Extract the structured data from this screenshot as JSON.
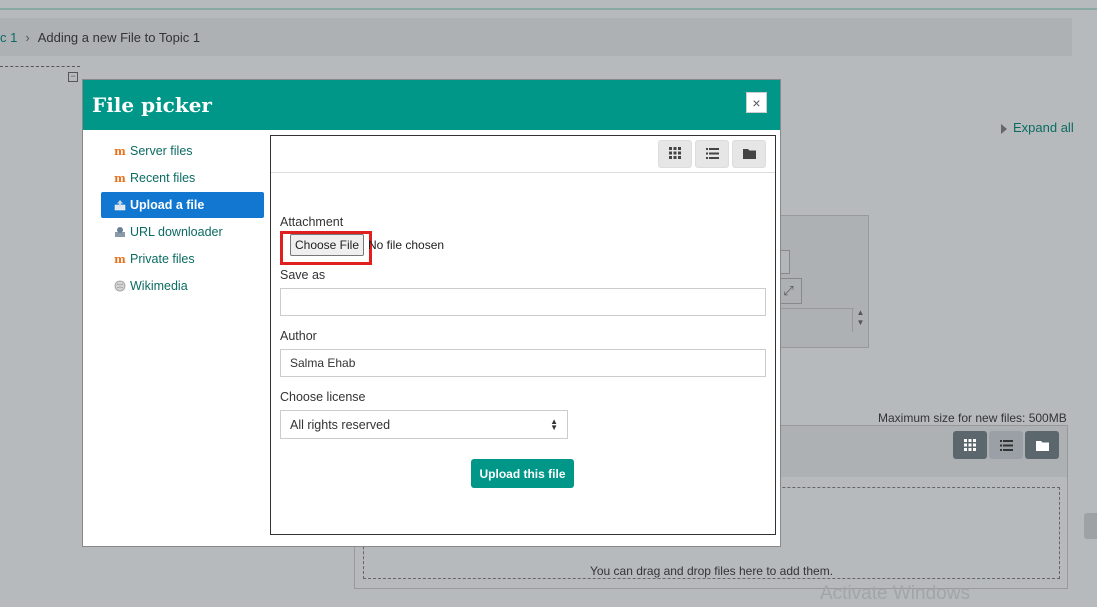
{
  "breadcrumb": {
    "partial_link": "c 1",
    "current": "Adding a new File to Topic 1"
  },
  "background": {
    "expand_all": "Expand all",
    "max_size": "Maximum size for new files: 500MB",
    "drop_text": "You can drag and drop files here to add them.",
    "watermark": "Activate Windows"
  },
  "modal": {
    "title": "File picker",
    "close_symbol": "×",
    "repositories": [
      {
        "label": "Server files",
        "icon": "moodle-icon"
      },
      {
        "label": "Recent files",
        "icon": "moodle-icon"
      },
      {
        "label": "Upload a file",
        "icon": "upload-icon",
        "active": true
      },
      {
        "label": "URL downloader",
        "icon": "url-icon"
      },
      {
        "label": "Private files",
        "icon": "moodle-icon"
      },
      {
        "label": "Wikimedia",
        "icon": "globe-icon"
      }
    ],
    "form": {
      "attachment_label": "Attachment",
      "choose_file": "Choose File",
      "no_file": "No file chosen",
      "save_as_label": "Save as",
      "save_as_value": "",
      "author_label": "Author",
      "author_value": "Salma Ehab",
      "license_label": "Choose license",
      "license_value": "All rights reserved",
      "upload_button": "Upload this file"
    }
  },
  "colors": {
    "header": "#009688",
    "active_repo": "#1177d1",
    "highlight": "#e02020",
    "link": "#0b6b62"
  }
}
